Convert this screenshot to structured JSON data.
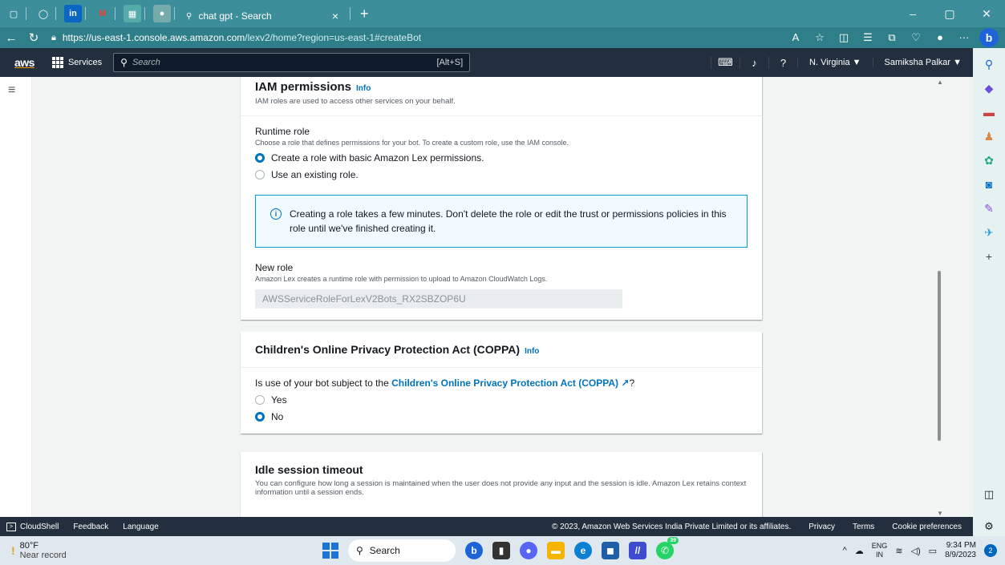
{
  "browser": {
    "tab_title": "chat gpt - Search",
    "tab_close": "×",
    "new_tab": "+",
    "url_host": "https://us-east-1.console.aws.amazon.com",
    "url_path": "/lexv2/home?region=us-east-1#createBot",
    "win_min": "–",
    "win_max": "▢",
    "win_close": "✕"
  },
  "aws_nav": {
    "logo": "aws",
    "services": "Services",
    "search_placeholder": "Search",
    "search_shortcut": "[Alt+S]",
    "region": "N. Virginia ▼",
    "user": "Samiksha Palkar ▼"
  },
  "iam": {
    "title": "IAM permissions",
    "info": "Info",
    "description": "IAM roles are used to access other services on your behalf.",
    "runtime_label": "Runtime role",
    "runtime_desc": "Choose a role that defines permissions for your bot. To create a custom role, use the IAM console.",
    "option_create": "Create a role with basic Amazon Lex permissions.",
    "option_existing": "Use an existing role.",
    "alert_text": "Creating a role takes a few minutes. Don't delete the role or edit the trust or permissions policies in this role until we've finished creating it.",
    "new_role_label": "New role",
    "new_role_desc": "Amazon Lex creates a runtime role with permission to upload to Amazon CloudWatch Logs.",
    "new_role_value": "AWSServiceRoleForLexV2Bots_RX2SBZOP6U"
  },
  "coppa": {
    "title": "Children's Online Privacy Protection Act (COPPA)",
    "info": "Info",
    "question_prefix": "Is use of your bot subject to the ",
    "question_link": "Children's Online Privacy Protection Act (COPPA)",
    "question_suffix": "?",
    "option_yes": "Yes",
    "option_no": "No"
  },
  "idle": {
    "title": "Idle session timeout",
    "description": "You can configure how long a session is maintained when the user does not provide any input and the session is idle. Amazon Lex retains context information until a session ends."
  },
  "footer": {
    "cloudshell": "CloudShell",
    "feedback": "Feedback",
    "language": "Language",
    "copyright": "© 2023, Amazon Web Services India Private Limited or its affiliates.",
    "privacy": "Privacy",
    "terms": "Terms",
    "cookies": "Cookie preferences"
  },
  "taskbar": {
    "temp": "80°F",
    "weather_note": "Near record",
    "search": "Search",
    "whatsapp_badge": "39",
    "lang_top": "ENG",
    "lang_bottom": "IN",
    "time": "9:34 PM",
    "date": "8/9/2023",
    "notif": "2"
  },
  "colors": {
    "browser_chrome": "#3b8e9a",
    "aws_nav": "#232f3e",
    "link": "#0073bb",
    "alert_border": "#00a1c9"
  }
}
